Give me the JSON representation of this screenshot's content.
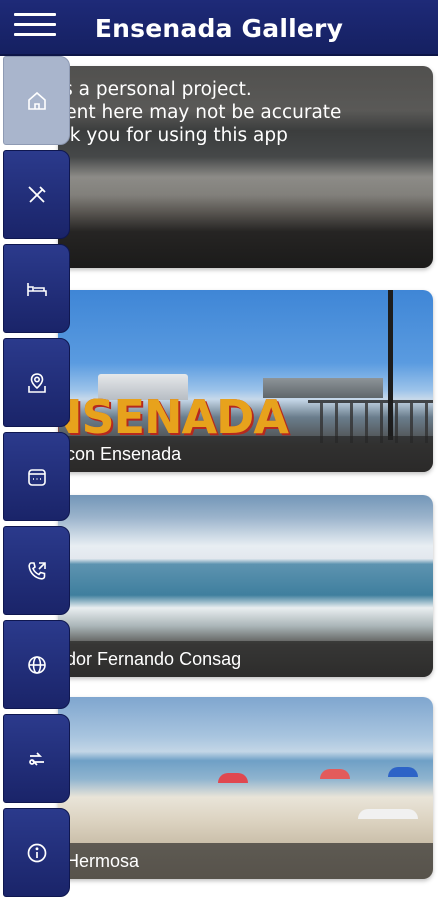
{
  "app": {
    "title": "Ensenada Gallery"
  },
  "notice": {
    "line1": "is a personal project.",
    "line2": "tent here may not be accurate",
    "line3": "nk you for using this app"
  },
  "cards": [
    {
      "caption": ""
    },
    {
      "caption": "con Ensenada",
      "sign_text": "NSENADA"
    },
    {
      "caption": "dor Fernando Consag"
    },
    {
      "caption": " Hermosa"
    }
  ],
  "side_nav": [
    {
      "icon": "home-icon",
      "active": true
    },
    {
      "icon": "food-icon"
    },
    {
      "icon": "bed-icon"
    },
    {
      "icon": "map-pin-icon"
    },
    {
      "icon": "calendar-icon"
    },
    {
      "icon": "phone-icon"
    },
    {
      "icon": "globe-icon"
    },
    {
      "icon": "currency-exchange-icon"
    },
    {
      "icon": "info-icon"
    }
  ],
  "colors": {
    "appbar": "#1e2a78",
    "rail_button": "#1a2469",
    "rail_active": "#a9b5cc"
  }
}
